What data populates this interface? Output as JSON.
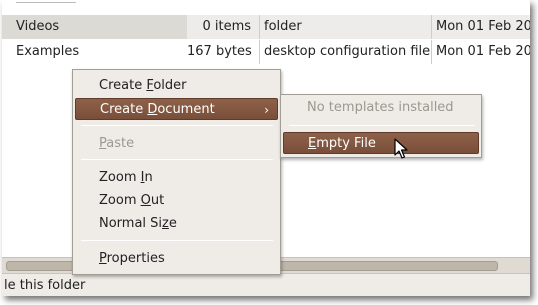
{
  "files": [
    {
      "name": "Videos",
      "size": "0 items",
      "type": "folder",
      "date": "Mon 01 Feb 20"
    },
    {
      "name": "Examples",
      "size": "167 bytes",
      "type": "desktop configuration file",
      "date": "Mon 01 Feb 20"
    }
  ],
  "status": {
    "text": "le this folder"
  },
  "context_menu": {
    "create_folder": {
      "pre": "Create ",
      "mn": "F",
      "post": "older"
    },
    "create_document": {
      "pre": "Create ",
      "mn": "D",
      "post": "ocument",
      "arrow": "›"
    },
    "paste": {
      "pre": "",
      "mn": "P",
      "post": "aste"
    },
    "zoom_in": {
      "pre": "Zoom ",
      "mn": "I",
      "post": "n"
    },
    "zoom_out": {
      "pre": "Zoom ",
      "mn": "O",
      "post": "ut"
    },
    "normal_size": {
      "pre": "Normal Si",
      "mn": "z",
      "post": "e"
    },
    "properties": {
      "pre": "",
      "mn": "P",
      "post": "roperties"
    }
  },
  "submenu": {
    "no_templates": "No templates installed",
    "empty_file": {
      "pre": "",
      "mn": "E",
      "post": "mpty File"
    }
  },
  "colors": {
    "highlight": "#7a4f3a",
    "menu_bg": "#efebe7"
  }
}
